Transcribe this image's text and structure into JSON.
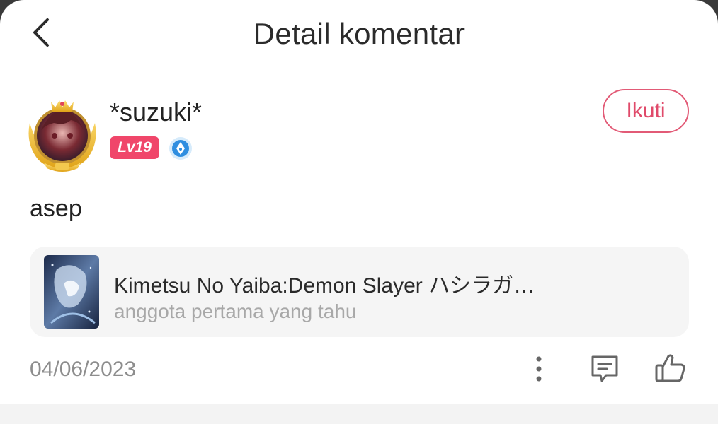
{
  "header": {
    "title": "Detail komentar",
    "back_icon": "chevron-left-icon"
  },
  "user": {
    "name": "*suzuki*",
    "level": "Lv19",
    "avatar_frame": "vip-gold-frame",
    "verified_icon": "pen-nib-badge-icon",
    "follow_label": "Ikuti"
  },
  "comment": {
    "text": "asep",
    "date": "04/06/2023"
  },
  "linked_item": {
    "title": "Kimetsu No Yaiba:Demon Slayer ハシラガ…",
    "subtitle": "anggota pertama yang tahu"
  },
  "actions": {
    "more_icon": "more-vertical-icon",
    "reply_icon": "comment-icon",
    "like_icon": "thumbs-up-icon"
  },
  "colors": {
    "accent": "#e04a6a",
    "level_badge": "#f0466a",
    "card_bg": "#f5f5f5",
    "muted_text": "#8d8d8d"
  }
}
